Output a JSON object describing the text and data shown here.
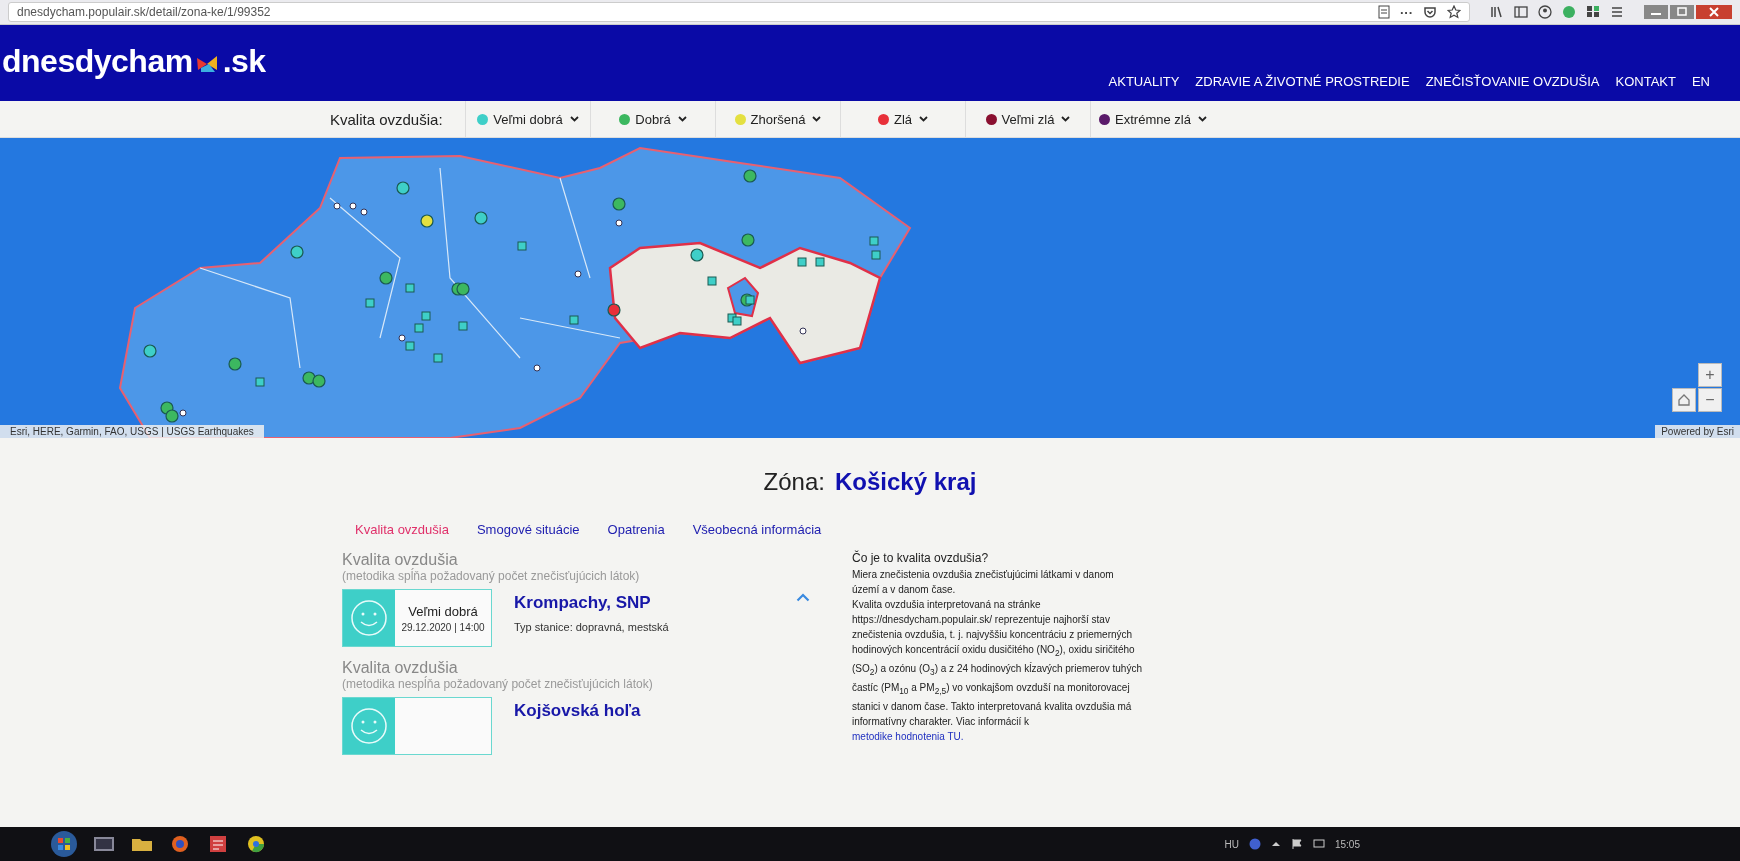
{
  "browser": {
    "url": "dnesdycham.populair.sk/detail/zona-ke/1/99352",
    "menu_glyph": "···"
  },
  "header": {
    "logo_text": "dnesdycham",
    "logo_suffix": ".sk",
    "nav": [
      {
        "label": "AKTUALITY"
      },
      {
        "label": "ZDRAVIE A ŽIVOTNÉ PROSTREDIE"
      },
      {
        "label": "ZNEČISŤOVANIE OVZDUŠIA"
      },
      {
        "label": "KONTAKT"
      },
      {
        "label": "EN"
      }
    ]
  },
  "legend": {
    "label": "Kvalita ovzdušia:",
    "items": [
      {
        "label": "Veľmi dobrá",
        "color": "#3ecfc8"
      },
      {
        "label": "Dobrá",
        "color": "#3cb860"
      },
      {
        "label": "Zhoršená",
        "color": "#e4e040"
      },
      {
        "label": "Zlá",
        "color": "#e8303a"
      },
      {
        "label": "Veľmi zlá",
        "color": "#8a1030"
      },
      {
        "label": "Extrémne zlá",
        "color": "#5a1a6a"
      }
    ]
  },
  "map": {
    "attribution": "Esri, HERE, Garmin, FAO, USGS | USGS Earthquakes",
    "powered_by": "Powered by Esri",
    "zoom_in": "+",
    "zoom_out": "−"
  },
  "zone": {
    "label": "Zóna:",
    "name": "Košický kraj"
  },
  "tabs": [
    {
      "label": "Kvalita ovzdušia",
      "selected": true
    },
    {
      "label": "Smogové situácie",
      "selected": false
    },
    {
      "label": "Opatrenia",
      "selected": false
    },
    {
      "label": "Všeobecná informácia",
      "selected": false
    }
  ],
  "sections": [
    {
      "title": "Kvalita ovzdušia",
      "subtitle": "(metodika  spĺňa požadovaný počet znečisťujúcich látok)",
      "station": {
        "color": "#3ecfc8",
        "quality": "Veľmi dobrá",
        "datetime": "29.12.2020  | 14:00",
        "name": "Krompachy, SNP",
        "type": "Typ stanice: dopravná, mestská",
        "expanded": true
      }
    },
    {
      "title": "Kvalita ovzdušia",
      "subtitle": "(metodika  nespĺňa požadovaný počet znečisťujúcich látok)",
      "station": {
        "color": "#3ecfc8",
        "name": "Kojšovská hoľa",
        "expanded": false
      }
    }
  ],
  "info": {
    "title": "Čo je to kvalita ovzdušia?",
    "lead": "Miera znečistenia ovzdušia znečisťujúcimi látkami v danom území a v danom čase.",
    "body": "Kvalita ovzdušia interpretovaná na stránke https://dnesdycham.populair.sk/ reprezentuje najhorší stav znečistenia ovzdušia, t. j. najvyššiu koncentráciu z priemerných hodinových koncentrácií oxidu dusičitého (NO$_{2}$), oxidu siričitého (SO$_{2}$) a ozónu (O$_{3}$) a z 24 hodinových kĺzavých priemerov tuhých častíc (PM$_{10}$ a PM$_{2,5}$) vo vonkajšom ovzduší na monitorovacej stanici v danom čase. Takto interpretovaná kvalita ovzdušia má informatívny charakter. Viac informácií k ",
    "link": "metodike hodnotenia TU."
  },
  "taskbar": {
    "language": "HU",
    "time": "15:05"
  }
}
